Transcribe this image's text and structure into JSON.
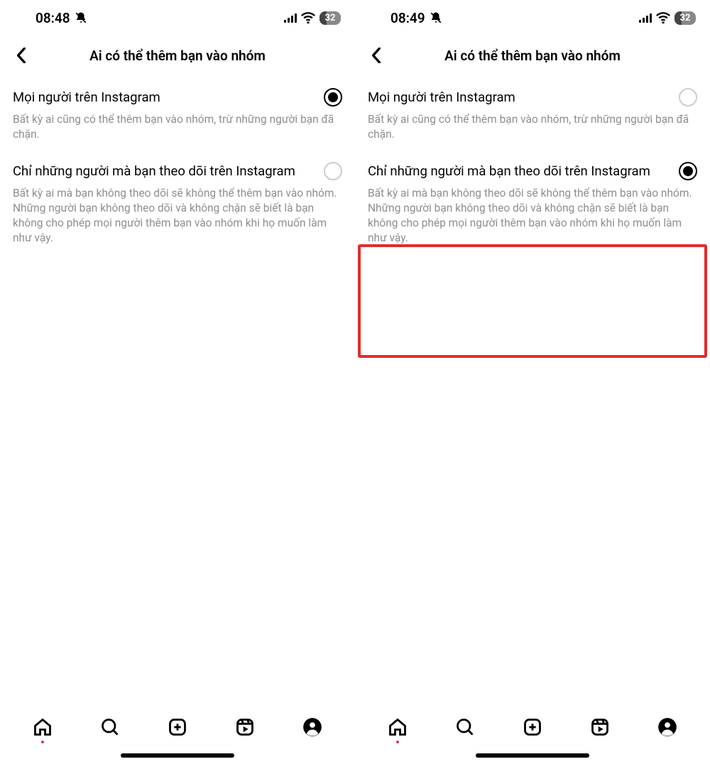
{
  "screens": [
    {
      "status": {
        "time": "08:48",
        "battery": "32"
      },
      "header": {
        "title": "Ai có thể thêm bạn vào nhóm"
      },
      "options": [
        {
          "label": "Mọi người trên Instagram",
          "desc": "Bất kỳ ai cũng có thể thêm bạn vào nhóm, trừ những người bạn đã chặn.",
          "selected": true
        },
        {
          "label": "Chỉ những người mà bạn theo dõi trên Instagram",
          "desc": "Bất kỳ ai mà bạn không theo dõi sẽ không thể thêm bạn vào nhóm. Những người bạn không theo dõi và không chặn sẽ biết là bạn không cho phép mọi người thêm bạn vào nhóm khi họ muốn làm như vậy.",
          "selected": false
        }
      ],
      "highlight": false
    },
    {
      "status": {
        "time": "08:49",
        "battery": "32"
      },
      "header": {
        "title": "Ai có thể thêm bạn vào nhóm"
      },
      "options": [
        {
          "label": "Mọi người trên Instagram",
          "desc": "Bất kỳ ai cũng có thể thêm bạn vào nhóm, trừ những người bạn đã chặn.",
          "selected": false
        },
        {
          "label": "Chỉ những người mà bạn theo dõi trên Instagram",
          "desc": "Bất kỳ ai mà bạn không theo dõi sẽ không thể thêm bạn vào nhóm. Những người bạn không theo dõi và không chặn sẽ biết là bạn không cho phép mọi người thêm bạn vào nhóm khi họ muốn làm như vậy.",
          "selected": true
        }
      ],
      "highlight": true
    }
  ]
}
